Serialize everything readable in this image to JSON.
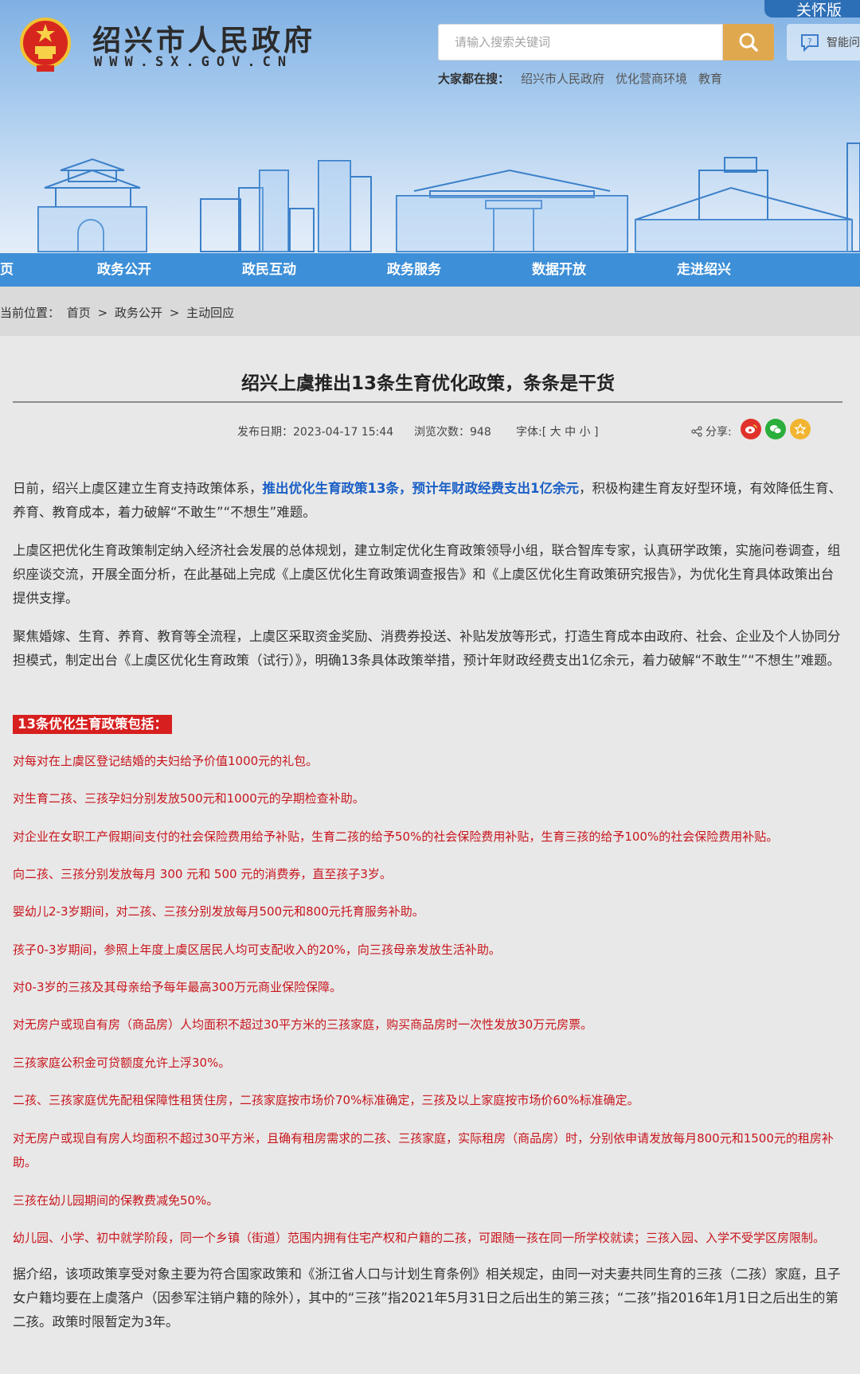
{
  "header": {
    "site_title": "绍兴市人民政府",
    "site_url": "WWW.SX.GOV.CN",
    "care_mode": "关怀版",
    "search_placeholder": "请输入搜索关键词",
    "ai_label": "智能问",
    "hot_label": "大家都在搜：",
    "hot_keywords": [
      "绍兴市人民政府",
      "优化营商环境",
      "教育"
    ]
  },
  "nav": {
    "items": [
      "页",
      "政务公开",
      "政民互动",
      "政务服务",
      "数据开放",
      "走进绍兴"
    ]
  },
  "breadcrumb": {
    "label": "当前位置：",
    "items": [
      "首页",
      ">",
      "政务公开",
      ">",
      "主动回应"
    ]
  },
  "article": {
    "title": "绍兴上虞推出13条生育优化政策，条条是干货",
    "publish_date": "发布日期：2023-04-17 15:44",
    "views": "浏览次数：948",
    "font_size": "字体:[ 大 中 小 ]",
    "share": "分享:",
    "share_icons": [
      "weibo-icon",
      "wechat-icon",
      "favorite-icon"
    ],
    "p1_before": "日前，绍兴上虞区建立生育支持政策体系，",
    "p1_highlight": "推出优化生育政策13条，预计年财政经费支出1亿余元",
    "p1_after": "，积极构建生育友好型环境，有效降低生育、养育、教育成本，着力破解“不敢生”“不想生”难题。",
    "p2": "上虞区把优化生育政策制定纳入经济社会发展的总体规划，建立制定优化生育政策领导小组，联合智库专家，认真研学政策，实施问卷调查，组织座谈交流，开展全面分析，在此基础上完成《上虞区优化生育政策调查报告》和《上虞区优化生育政策研究报告》，为优化生育具体政策出台提供支撑。",
    "p3": "聚焦婚嫁、生育、养育、教育等全流程，上虞区采取资金奖励、消费券投送、补贴发放等形式，打造生育成本由政府、社会、企业及个人协同分担模式，制定出台《上虞区优化生育政策（试行）》，明确13条具体政策举措，预计年财政经费支出1亿余元，着力破解“不敢生”“不想生”难题。",
    "policy_heading": "13条优化生育政策包括：",
    "policies": [
      "对每对在上虞区登记结婚的夫妇给予价值1000元的礼包。",
      "对生育二孩、三孩孕妇分别发放500元和1000元的孕期检查补助。",
      "对企业在女职工产假期间支付的社会保险费用给予补贴，生育二孩的给予50%的社会保险费用补贴，生育三孩的给予100%的社会保险费用补贴。",
      "向二孩、三孩分别发放每月 300 元和 500 元的消费券，直至孩子3岁。",
      "婴幼儿2-3岁期间，对二孩、三孩分别发放每月500元和800元托育服务补助。",
      "孩子0-3岁期间，参照上年度上虞区居民人均可支配收入的20%，向三孩母亲发放生活补助。",
      "对0-3岁的三孩及其母亲给予每年最高300万元商业保险保障。",
      "对无房户或现自有房（商品房）人均面积不超过30平方米的三孩家庭，购买商品房时一次性发放30万元房票。",
      "三孩家庭公积金可贷额度允许上浮30%。",
      "二孩、三孩家庭优先配租保障性租赁住房，二孩家庭按市场价70%标准确定，三孩及以上家庭按市场价60%标准确定。",
      "对无房户或现自有房人均面积不超过30平方米，且确有租房需求的二孩、三孩家庭，实际租房（商品房）时，分别依申请发放每月800元和1500元的租房补助。",
      "三孩在幼儿园期间的保教费减免50%。",
      "幼儿园、小学、初中就学阶段，同一个乡镇（街道）范围内拥有住宅产权和户籍的二孩，可跟随一孩在同一所学校就读；三孩入园、入学不受学区房限制。"
    ],
    "p_final": "据介绍，该项政策享受对象主要为符合国家政策和《浙江省人口与计划生育条例》相关规定，由同一对夫妻共同生育的三孩（二孩）家庭，且子女户籍均要在上虞落户（因参军注销户籍的除外），其中的“三孩”指2021年5月31日之后出生的第三孩；“二孩”指2016年1月1日之后出生的第二孩。政策时限暂定为3年。"
  },
  "colors": {
    "nav_blue": "#3d8fd8",
    "search_orange": "#e0a84e",
    "highlight_blue": "#1a5fc6",
    "policy_red": "#c8161d"
  }
}
